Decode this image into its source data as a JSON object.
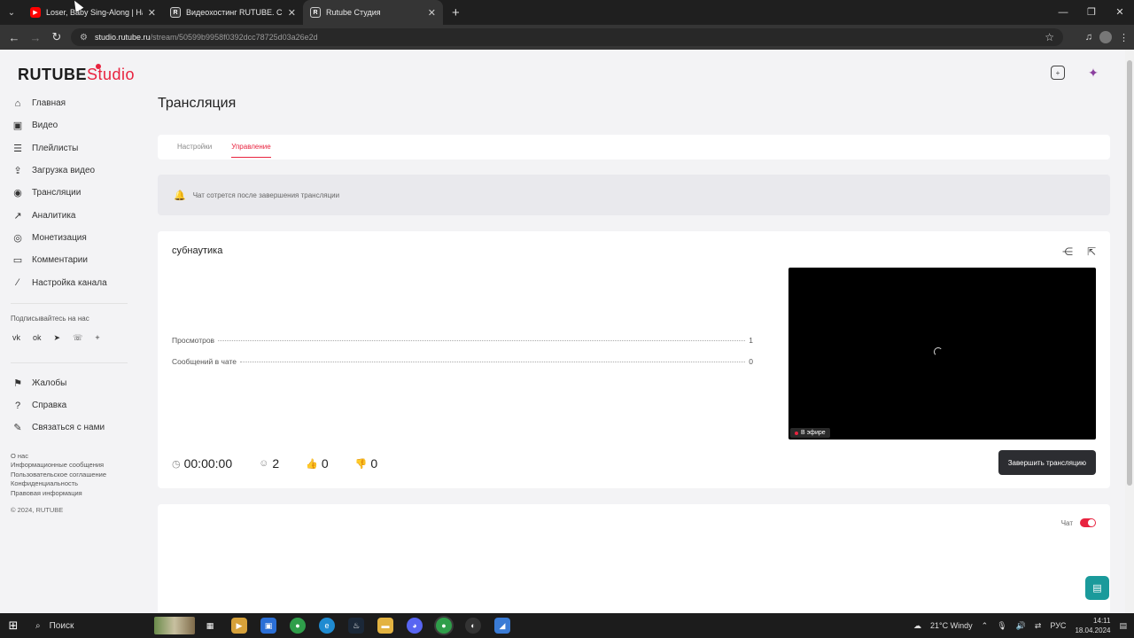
{
  "browser": {
    "tabs": [
      {
        "title": "Loser, Baby Sing-Along | Hazbi",
        "favicon": "youtube-icon",
        "active": false
      },
      {
        "title": "Видеохостинг RUTUBE. Смотр",
        "favicon": "rutube-icon",
        "active": false
      },
      {
        "title": "Rutube Студия",
        "favicon": "rutube-icon",
        "active": true
      }
    ],
    "url_host": "studio.rutube.ru",
    "url_path": "/stream/50599b9958f0392dcc78725d03a26e2d"
  },
  "app": {
    "logo_main": "RUTUBE",
    "logo_sub": "Studio",
    "accent_color": "#e8233f"
  },
  "sidebar": {
    "items": [
      {
        "label": "Главная",
        "icon": "home-icon"
      },
      {
        "label": "Видео",
        "icon": "video-icon"
      },
      {
        "label": "Плейлисты",
        "icon": "playlist-icon"
      },
      {
        "label": "Загрузка видео",
        "icon": "upload-icon"
      },
      {
        "label": "Трансляции",
        "icon": "broadcast-icon"
      },
      {
        "label": "Аналитика",
        "icon": "analytics-icon"
      },
      {
        "label": "Монетизация",
        "icon": "money-icon"
      },
      {
        "label": "Комментарии",
        "icon": "comments-icon"
      },
      {
        "label": "Настройка канала",
        "icon": "wand-icon"
      }
    ],
    "follow_label": "Подписывайтесь на нас",
    "socials": [
      "vk",
      "ok",
      "telegram",
      "viber",
      "more"
    ],
    "support_items": [
      {
        "label": "Жалобы",
        "icon": "flag-icon"
      },
      {
        "label": "Справка",
        "icon": "help-icon"
      },
      {
        "label": "Связаться с нами",
        "icon": "pencil-icon"
      }
    ],
    "footer_links": [
      "О нас",
      "Информационные сообщения",
      "Пользовательское соглашение",
      "Конфиденциальность",
      "Правовая информация"
    ],
    "copyright": "© 2024, RUTUBE"
  },
  "main": {
    "title": "Трансляция",
    "tabs": [
      {
        "label": "Настройки",
        "active": false
      },
      {
        "label": "Управление",
        "active": true
      }
    ],
    "alert": "Чат сотрется после завершения трансляции",
    "stream": {
      "title": "субнаутика",
      "stats": [
        {
          "label": "Просмотров",
          "value": "1"
        },
        {
          "label": "Сообщений в чате",
          "value": "0"
        }
      ],
      "live_label": "В эфире",
      "duration": "00:00:00",
      "viewers": "2",
      "likes": "0",
      "dislikes": "0",
      "end_button": "Завершить трансляцию"
    },
    "chat": {
      "toggle_label": "Чат",
      "enabled": true
    }
  },
  "taskbar": {
    "search_placeholder": "Поиск",
    "weather": "21°C  Windy",
    "lang": "РУС",
    "time": "14:11",
    "date": "18.04.2024"
  }
}
